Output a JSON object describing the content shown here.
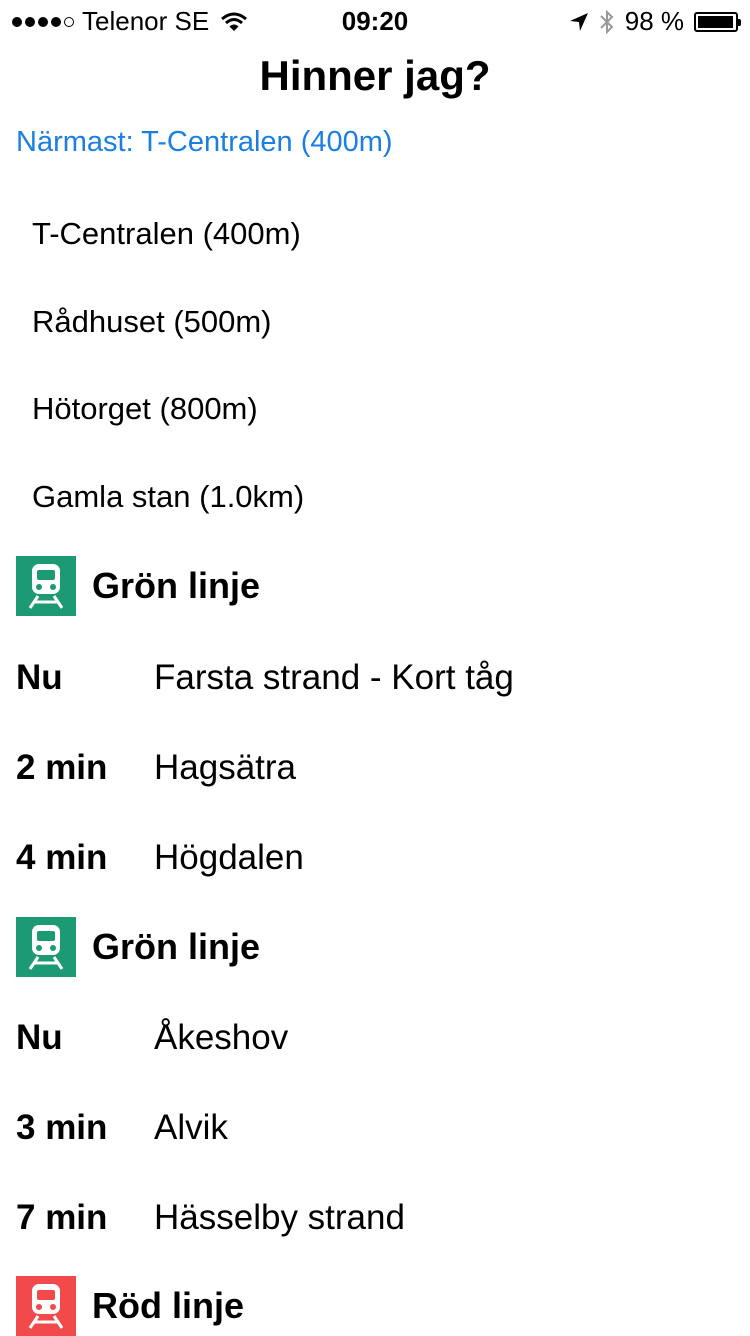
{
  "status_bar": {
    "carrier": "Telenor SE",
    "time": "09:20",
    "battery_text": "98 %",
    "battery_level": 0.98
  },
  "title": "Hinner jag?",
  "nearest": {
    "label": "Närmast: T-Centralen (400m)"
  },
  "stations": [
    {
      "label": "T-Centralen (400m)"
    },
    {
      "label": "Rådhuset (500m)"
    },
    {
      "label": "Hötorget (800m)"
    },
    {
      "label": "Gamla stan (1.0km)"
    }
  ],
  "lines": [
    {
      "name": "Grön linje",
      "color": "#1b9a73",
      "icon": "train-icon",
      "departures": [
        {
          "time": "Nu",
          "destination": "Farsta strand - Kort tåg"
        },
        {
          "time": "2 min",
          "destination": "Hagsätra"
        },
        {
          "time": "4 min",
          "destination": "Högdalen"
        }
      ]
    },
    {
      "name": "Grön linje",
      "color": "#1b9a73",
      "icon": "train-icon",
      "departures": [
        {
          "time": "Nu",
          "destination": "Åkeshov"
        },
        {
          "time": "3 min",
          "destination": "Alvik"
        },
        {
          "time": "7 min",
          "destination": "Hässelby strand"
        }
      ]
    },
    {
      "name": "Röd linje",
      "color": "#f24a4a",
      "icon": "train-icon",
      "departures": []
    }
  ]
}
